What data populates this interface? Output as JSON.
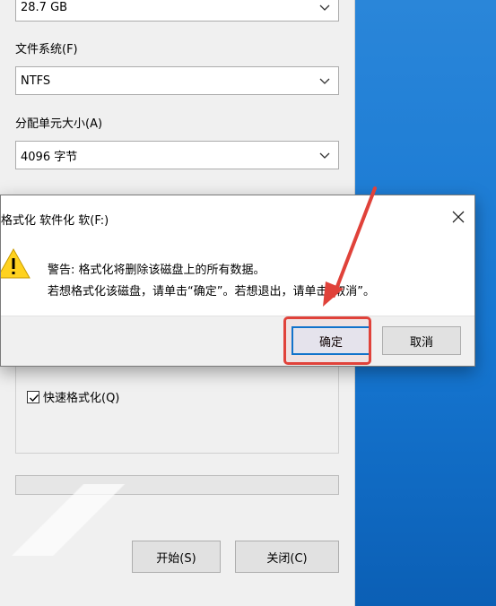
{
  "format_window": {
    "capacity_value": "28.7 GB",
    "filesystem_label": "文件系统(F)",
    "filesystem_value": "NTFS",
    "alloc_label": "分配单元大小(A)",
    "alloc_value": "4096 字节",
    "quick_format_label": "快速格式化(Q)",
    "quick_format_checked": true,
    "start_button": "开始(S)",
    "close_button": "关闭(C)"
  },
  "dialog": {
    "title": "格式化 软件化 软(F:)",
    "message_line1": "警告: 格式化将删除该磁盘上的所有数据。",
    "message_line2": "若想格式化该磁盘，请单击“确定”。若想退出，请单击“取消”。",
    "ok_button": "确定",
    "cancel_button": "取消"
  },
  "annotation": {
    "arrow_color": "#e0423a",
    "highlight_color": "#e0423a"
  }
}
